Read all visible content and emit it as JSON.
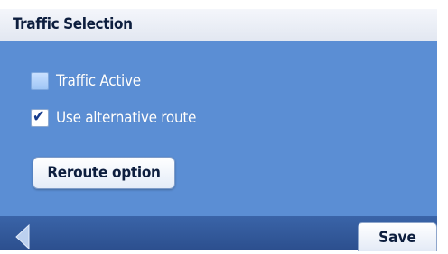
{
  "header": {
    "title": "Traffic Selection"
  },
  "options": [
    {
      "label": "Traffic Active",
      "checked": false
    },
    {
      "label": "Use alternative route",
      "checked": true
    }
  ],
  "buttons": {
    "reroute_label": "Reroute option",
    "save_label": "Save",
    "back_icon": "chevron-left-icon"
  },
  "colors": {
    "content_background": "#5b8ed4",
    "bottom_bar": "#2f5597",
    "title_text": "#0d1e3e"
  }
}
